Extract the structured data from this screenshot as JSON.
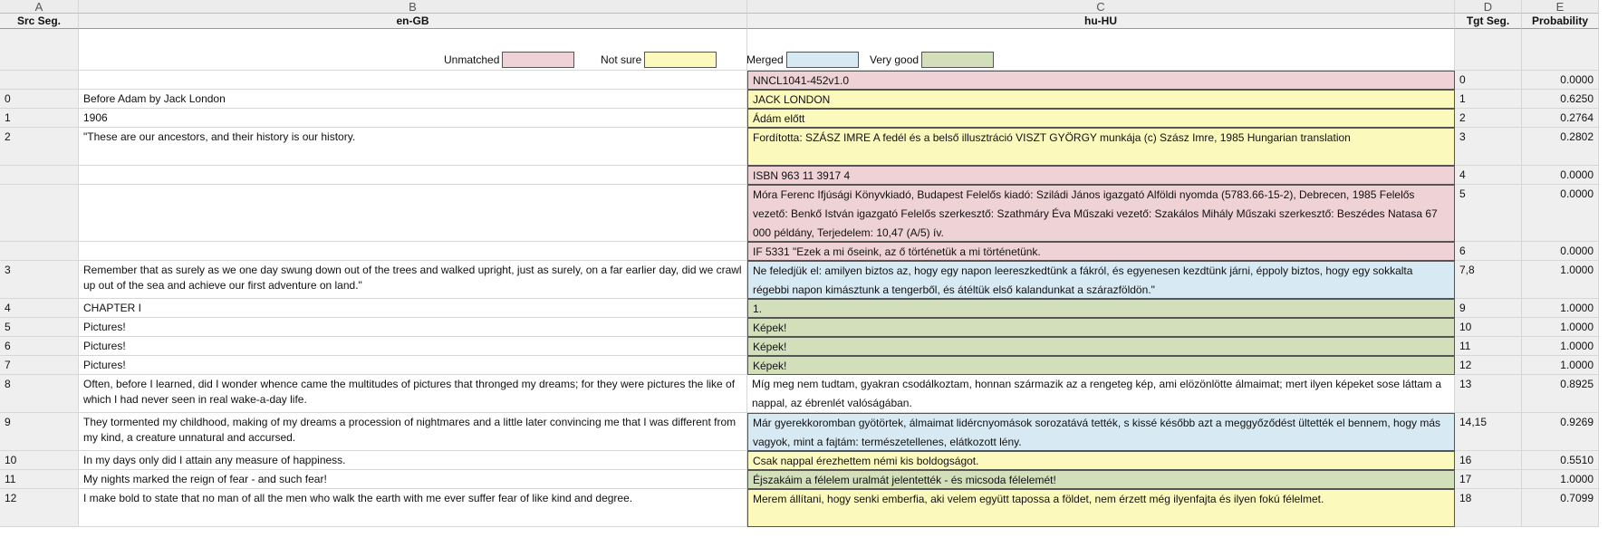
{
  "sheet": {
    "col_letters": [
      "A",
      "B",
      "C",
      "D",
      "E"
    ],
    "headers": {
      "a": "Src Seg.",
      "b": "en-GB",
      "c": "hu-HU",
      "d": "Tgt Seg.",
      "e": "Probability"
    },
    "legend": [
      {
        "label": "Unmatched",
        "color": "#efd2d5"
      },
      {
        "label": "Not sure",
        "color": "#fcf9bd"
      },
      {
        "label": "Merged",
        "color": "#d7e9f3"
      },
      {
        "label": "Very good",
        "color": "#d3dfbb"
      }
    ],
    "rows": [
      {
        "src": "",
        "en": "",
        "hu": "NNCL1041-452v1.0",
        "tgt": "0",
        "prob": "0.0000",
        "status": "unmatched",
        "lines": 1
      },
      {
        "src": "0",
        "en": "Before Adam by Jack London",
        "hu": "JACK LONDON",
        "tgt": "1",
        "prob": "0.6250",
        "status": "notsure",
        "lines": 1
      },
      {
        "src": "1",
        "en": "1906",
        "hu": "Ádám előtt",
        "tgt": "2",
        "prob": "0.2764",
        "status": "notsure",
        "lines": 1
      },
      {
        "src": "2",
        "en": "\"These are our ancestors, and their history is our history.",
        "hu": "Fordította: SZÁSZ IMRE A fedél és a belső illusztráció VISZT GYÖRGY munkája (c) Szász Imre, 1985 Hungarian translation",
        "tgt": "3",
        "prob": "0.2802",
        "status": "notsure",
        "lines": 2
      },
      {
        "src": "",
        "en": "",
        "hu": "ISBN 963 11 3917 4",
        "tgt": "4",
        "prob": "0.0000",
        "status": "unmatched",
        "lines": 1
      },
      {
        "src": "",
        "en": "",
        "hu": "Móra Ferenc Ifjúsági Könyvkiadó, Budapest Felelős kiadó: Sziládi János igazgató Alföldi nyomda (5783.66-15-2), Debrecen, 1985 Felelős vezető: Benkő István igazgató Felelős szerkesztő: Szathmáry Éva Műszaki vezető: Szakálos Mihály Műszaki szerkesztő: Beszédes Natasa 67 000 példány, Terjedelem: 10,47 (A/5) ív.",
        "tgt": "5",
        "prob": "0.0000",
        "status": "unmatched",
        "lines": 3
      },
      {
        "src": "",
        "en": "",
        "hu": "IF 5331 \"Ezek a mi őseink, az ő történetük a mi történetünk.",
        "tgt": "6",
        "prob": "0.0000",
        "status": "unmatched",
        "lines": 1
      },
      {
        "src": "3",
        "en": "Remember that as surely as we one day swung down out of the trees and walked upright, just as surely, on a far earlier day, did we crawl up out of the sea and achieve our first adventure on land.\"",
        "hu": "Ne feledjük el: amilyen biztos az, hogy egy napon leereszkedtünk a fákról, és egyenesen kezdtünk járni, éppoly biztos, hogy egy sokkalta régebbi napon kimásztunk a tengerből, és átéltük első kalandunkat a szárazföldön.\"",
        "tgt": "7,8",
        "prob": "1.0000",
        "status": "merged",
        "lines": 2
      },
      {
        "src": "4",
        "en": "CHAPTER I",
        "hu": "1.",
        "tgt": "9",
        "prob": "1.0000",
        "status": "verygood",
        "lines": 1
      },
      {
        "src": "5",
        "en": "Pictures!",
        "hu": "Képek!",
        "tgt": "10",
        "prob": "1.0000",
        "status": "verygood",
        "lines": 1
      },
      {
        "src": "6",
        "en": "Pictures!",
        "hu": "Képek!",
        "tgt": "11",
        "prob": "1.0000",
        "status": "verygood",
        "lines": 1
      },
      {
        "src": "7",
        "en": "Pictures!",
        "hu": "Képek!",
        "tgt": "12",
        "prob": "1.0000",
        "status": "verygood",
        "lines": 1
      },
      {
        "src": "8",
        "en": "Often, before I learned, did I wonder whence came the multitudes of pictures that thronged my dreams; for they were pictures the like of which I had never seen in real wake-a-day life.",
        "hu": "Míg meg nem tudtam, gyakran csodálkoztam, honnan származik az a rengeteg kép, ami elözönlötte álmaimat; mert ilyen képeket sose láttam a nappal, az ébrenlét valóságában.",
        "tgt": "13",
        "prob": "0.8925",
        "status": "none",
        "lines": 2
      },
      {
        "src": "9",
        "en": "They tormented my childhood, making of my dreams a procession of nightmares and a little later convincing me that I was different from my kind, a creature unnatural and accursed.",
        "hu": "Már gyerekkoromban gyötörtek, álmaimat lidércnyomások sorozatává tették, s kissé később azt a meggyőződést ültették el bennem, hogy más vagyok, mint a fajtám: természetellenes, elátkozott lény.",
        "tgt": "14,15",
        "prob": "0.9269",
        "status": "merged",
        "lines": 2
      },
      {
        "src": "10",
        "en": "In my days only did I attain any measure of happiness.",
        "hu": "Csak nappal érezhettem némi kis boldogságot.",
        "tgt": "16",
        "prob": "0.5510",
        "status": "notsure",
        "lines": 1
      },
      {
        "src": "11",
        "en": "My nights marked the reign of fear - and such fear!",
        "hu": "Éjszakáim a félelem uralmát jelentették - és micsoda félelemét!",
        "tgt": "17",
        "prob": "1.0000",
        "status": "verygood",
        "lines": 1
      },
      {
        "src": "12",
        "en": "I make bold to state that no man of all the men who walk the earth with me ever suffer fear of like kind and degree.",
        "hu": "Merem állítani, hogy senki emberfia, aki velem együtt tapossa a földet, nem érzett még ilyenfajta és ilyen fokú félelmet.",
        "tgt": "18",
        "prob": "0.7099",
        "status": "notsure",
        "lines": 2
      }
    ]
  }
}
